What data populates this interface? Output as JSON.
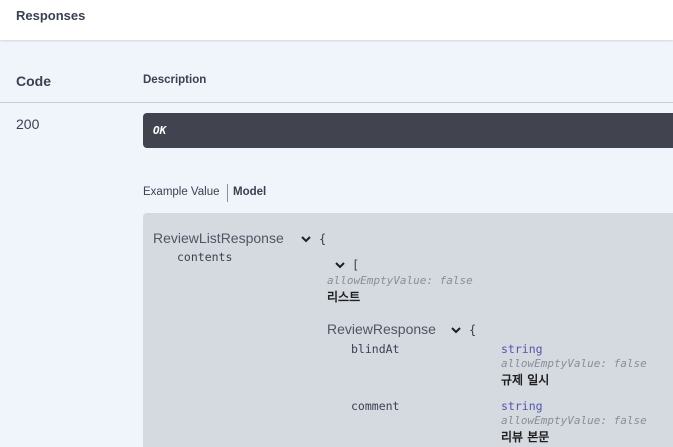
{
  "responses": {
    "title": "Responses"
  },
  "table": {
    "code_header": "Code",
    "description_header": "Description",
    "rows": [
      {
        "code": "200",
        "description": "OK"
      }
    ]
  },
  "tabs": {
    "example_value": "Example Value",
    "model": "Model",
    "active": "Model"
  },
  "model": {
    "name": "ReviewListResponse",
    "open_brace": "{",
    "properties": [
      {
        "name": "contents",
        "open_bracket": "[",
        "meta": "allowEmptyValue: false",
        "description": "리스트",
        "item_model": {
          "name": "ReviewResponse",
          "open_brace": "{",
          "properties": [
            {
              "name": "blindAt",
              "type": "string",
              "meta": "allowEmptyValue: false",
              "description": "규제 일시"
            },
            {
              "name": "comment",
              "type": "string",
              "meta": "allowEmptyValue: false",
              "description": "리뷰 본문"
            }
          ]
        }
      }
    ]
  },
  "icons": {
    "expand": "chevron-down-icon"
  },
  "colors": {
    "header_bg": "#ffffff",
    "content_bg": "#f0f4fb",
    "ok_box_bg": "#41444e",
    "model_box_bg": "#d5d9e0",
    "type_color": "#5555aa",
    "meta_color": "#888e99"
  }
}
